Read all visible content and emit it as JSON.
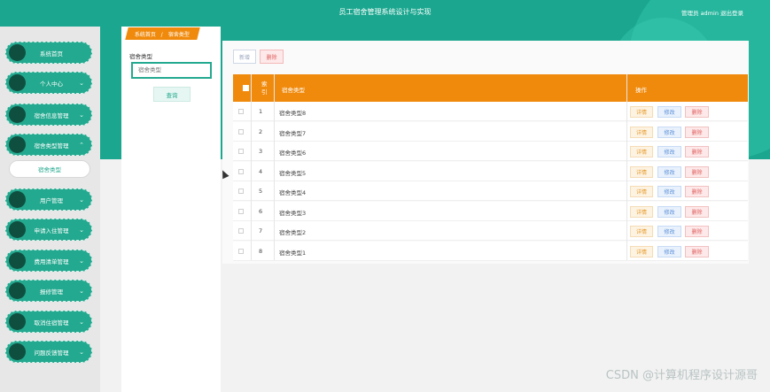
{
  "header": {
    "title": "员工宿舍管理系统设计与实现",
    "user_info": "管理员 admin  退出登录"
  },
  "sidebar": {
    "items": [
      {
        "label": "系统首页",
        "has_chevron": false
      },
      {
        "label": "个人中心",
        "has_chevron": true
      },
      {
        "label": "宿舍信息管理",
        "has_chevron": true
      },
      {
        "label": "宿舍类型管理",
        "has_chevron": true
      },
      {
        "label": "用户管理",
        "has_chevron": true
      },
      {
        "label": "申请入住管理",
        "has_chevron": true
      },
      {
        "label": "费用清单管理",
        "has_chevron": true
      },
      {
        "label": "报修管理",
        "has_chevron": true
      },
      {
        "label": "取消住宿管理",
        "has_chevron": true
      },
      {
        "label": "问题反馈管理",
        "has_chevron": true
      }
    ],
    "expanded_chevron": "⌃",
    "collapsed_chevron": "⌄",
    "submenu_item": "宿舍类型"
  },
  "breadcrumb": {
    "home": "系统首页",
    "separator": "/",
    "current": "宿舍类型"
  },
  "search": {
    "label": "宿舍类型",
    "placeholder": "宿舍类型",
    "button": "查询"
  },
  "toolbar": {
    "new_label": "新增",
    "delete_label": "删除"
  },
  "table": {
    "headers": {
      "index": "索\n引",
      "type": "宿舍类型",
      "action": "操作"
    },
    "rows": [
      {
        "index": "1",
        "name": "宿舍类型8"
      },
      {
        "index": "2",
        "name": "宿舍类型7"
      },
      {
        "index": "3",
        "name": "宿舍类型6"
      },
      {
        "index": "4",
        "name": "宿舍类型5"
      },
      {
        "index": "5",
        "name": "宿舍类型4"
      },
      {
        "index": "6",
        "name": "宿舍类型3"
      },
      {
        "index": "7",
        "name": "宿舍类型2"
      },
      {
        "index": "8",
        "name": "宿舍类型1"
      }
    ],
    "row_actions": {
      "detail": "详情",
      "edit": "修改",
      "delete": "删除"
    }
  },
  "watermark": "CSDN @计算机程序设计源哥",
  "colors": {
    "primary": "#1ba78f",
    "accent": "#f08a0c",
    "danger": "#e06060"
  }
}
